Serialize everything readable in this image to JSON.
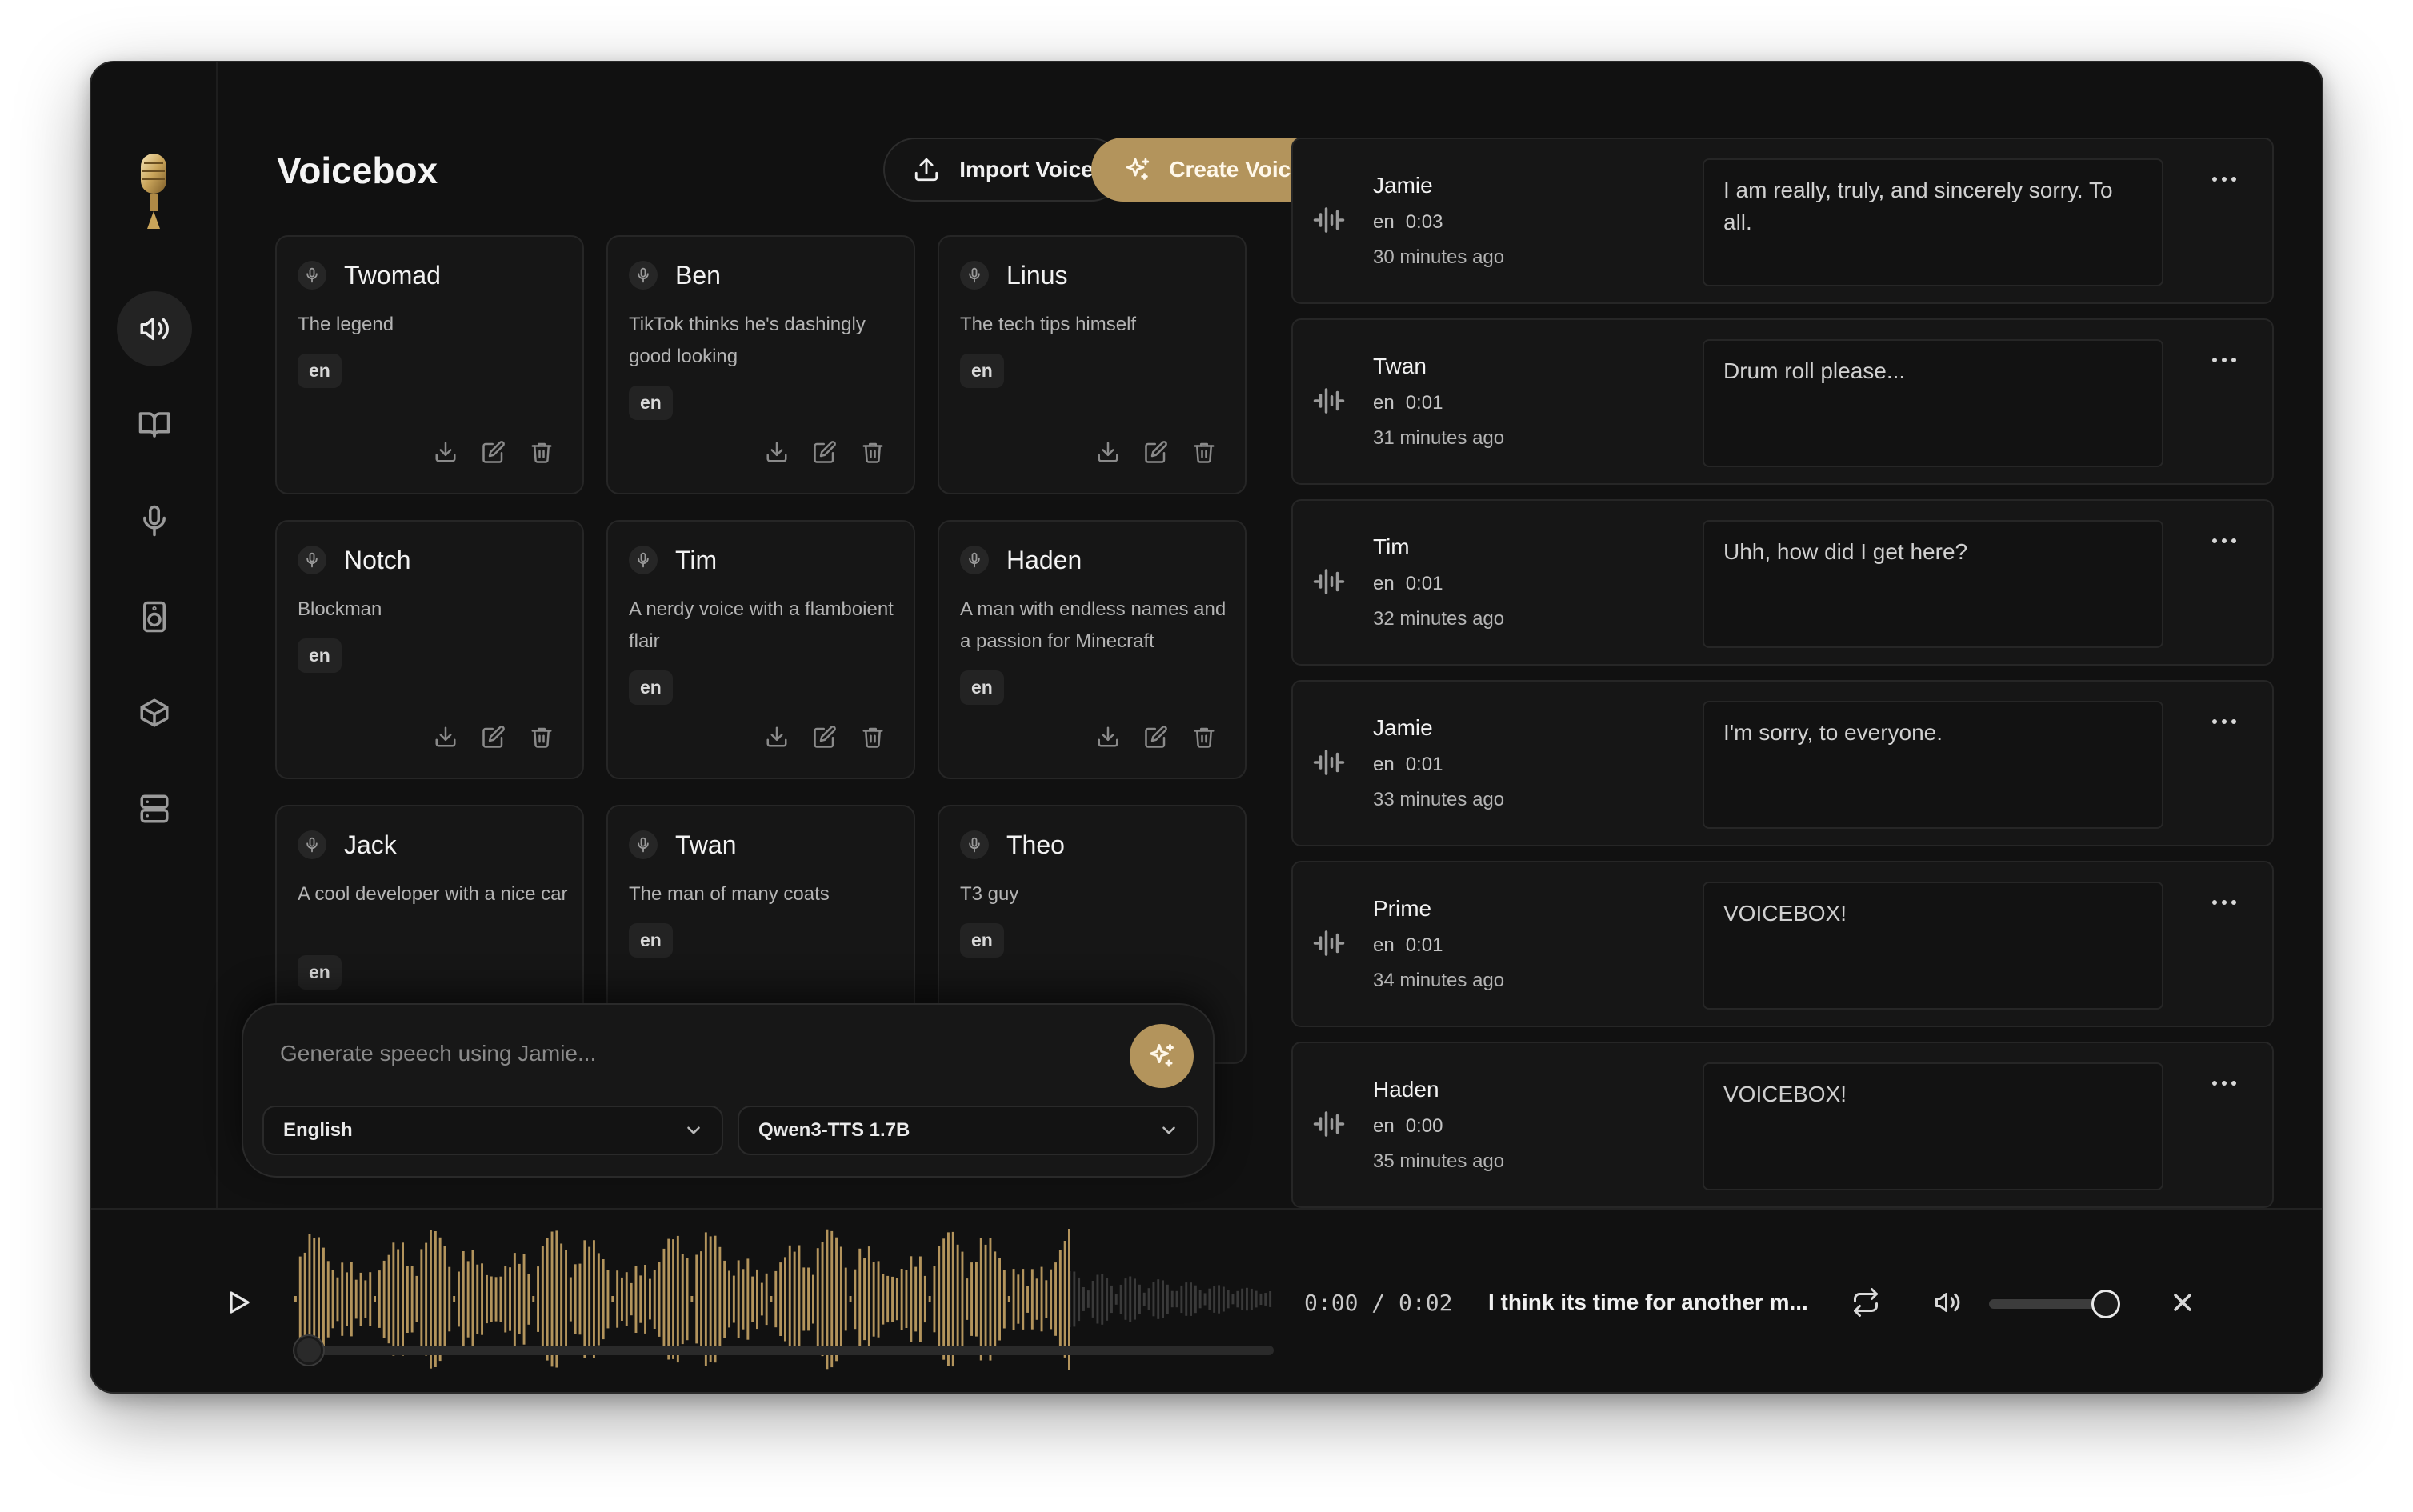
{
  "app": {
    "title": "Voicebox",
    "import_label": "Import Voice",
    "create_label": "Create Voice"
  },
  "sidebar": {
    "items": [
      {
        "icon": "speaker-icon",
        "active": true
      },
      {
        "icon": "book-icon",
        "active": false
      },
      {
        "icon": "microphone-icon",
        "active": false
      },
      {
        "icon": "audio-box-icon",
        "active": false
      },
      {
        "icon": "cube-icon",
        "active": false
      },
      {
        "icon": "server-icon",
        "active": false
      }
    ]
  },
  "voices": [
    {
      "name": "Twomad",
      "description": "The legend",
      "language": "en"
    },
    {
      "name": "Ben",
      "description": "TikTok thinks he's dashingly good looking",
      "language": "en"
    },
    {
      "name": "Linus",
      "description": "The tech tips himself",
      "language": "en"
    },
    {
      "name": "Notch",
      "description": "Blockman",
      "language": "en"
    },
    {
      "name": "Tim",
      "description": "A nerdy voice with a flamboient flair",
      "language": "en"
    },
    {
      "name": "Haden",
      "description": "A man with endless names and a passion for Minecraft",
      "language": "en"
    },
    {
      "name": "Jack",
      "description": "A cool developer with a nice car",
      "language": "en"
    },
    {
      "name": "Twan",
      "description": "The man of many coats",
      "language": "en"
    },
    {
      "name": "Theo",
      "description": "T3 guy",
      "language": "en"
    }
  ],
  "generator": {
    "placeholder": "Generate speech using Jamie...",
    "language": "English",
    "model": "Qwen3-TTS 1.7B"
  },
  "history": [
    {
      "voice": "Jamie",
      "language": "en",
      "duration": "0:03",
      "ago": "30 minutes ago",
      "text": "I am really, truly, and sincerely sorry. To all."
    },
    {
      "voice": "Twan",
      "language": "en",
      "duration": "0:01",
      "ago": "31 minutes ago",
      "text": "Drum roll please..."
    },
    {
      "voice": "Tim",
      "language": "en",
      "duration": "0:01",
      "ago": "32 minutes ago",
      "text": "Uhh, how did I get here?"
    },
    {
      "voice": "Jamie",
      "language": "en",
      "duration": "0:01",
      "ago": "33 minutes ago",
      "text": "I'm sorry, to everyone."
    },
    {
      "voice": "Prime",
      "language": "en",
      "duration": "0:01",
      "ago": "34 minutes ago",
      "text": "VOICEBOX!"
    },
    {
      "voice": "Haden",
      "language": "en",
      "duration": "0:00",
      "ago": "35 minutes ago",
      "text": "VOICEBOX!"
    }
  ],
  "player": {
    "current_time": "0:00",
    "separator": "/",
    "total_time": "0:02",
    "title": "I think its time for another m...",
    "progress": 0,
    "volume": 0.85,
    "accent": "#b3945c"
  }
}
